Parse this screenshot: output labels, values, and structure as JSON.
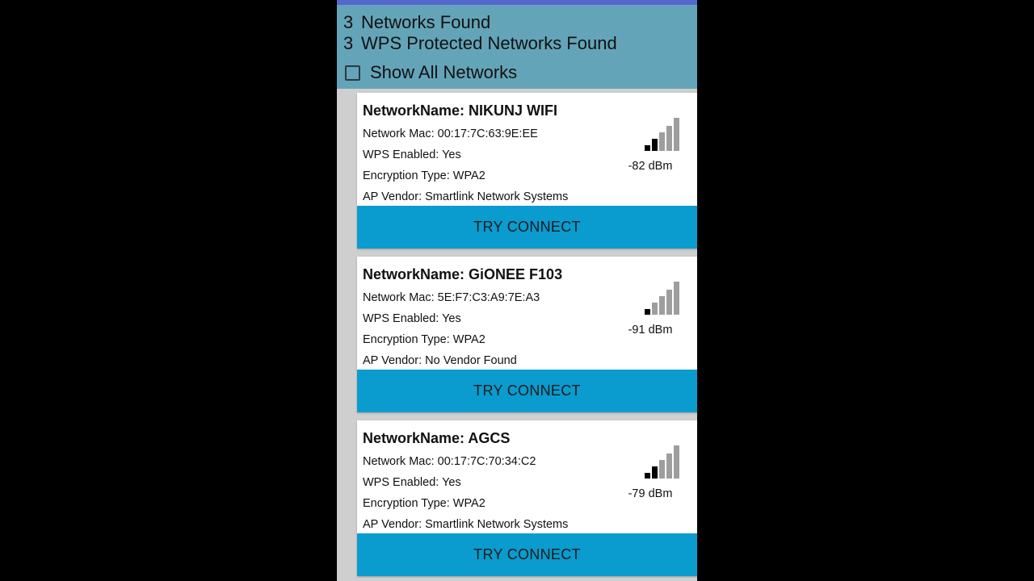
{
  "header": {
    "networks_count": "3",
    "networks_label": "Networks Found",
    "wps_count": "3",
    "wps_label": "WPS Protected Networks Found",
    "show_all_label": "Show All Networks",
    "show_all_checked": false
  },
  "networks": [
    {
      "name": "NetworkName: NIKUNJ WIFI",
      "mac": "Network Mac: 00:17:7C:63:9E:EE",
      "wps": "WPS Enabled: Yes",
      "encryption": "Encryption Type: WPA2",
      "vendor": "AP Vendor: Smartlink Network Systems",
      "signal": "-82 dBm",
      "signal_level": 2,
      "button": "TRY CONNECT"
    },
    {
      "name": "NetworkName: GiONEE F103",
      "mac": "Network Mac: 5E:F7:C3:A9:7E:A3",
      "wps": "WPS Enabled: Yes",
      "encryption": "Encryption Type: WPA2",
      "vendor": "AP Vendor: No Vendor Found",
      "signal": "-91 dBm",
      "signal_level": 1,
      "button": "TRY CONNECT"
    },
    {
      "name": "NetworkName: AGCS",
      "mac": "Network Mac: 00:17:7C:70:34:C2",
      "wps": "WPS Enabled: Yes",
      "encryption": "Encryption Type: WPA2",
      "vendor": "AP Vendor: Smartlink Network Systems",
      "signal": "-79 dBm",
      "signal_level": 2,
      "button": "TRY CONNECT"
    }
  ],
  "colors": {
    "header_bg": "#64a4b8",
    "button_bg": "#0a9bcf",
    "signal_active": "#000000",
    "signal_inactive": "#9e9e9e"
  },
  "icons": {
    "signal": "signal-strength-icon",
    "checkbox": "checkbox-unchecked-icon"
  }
}
